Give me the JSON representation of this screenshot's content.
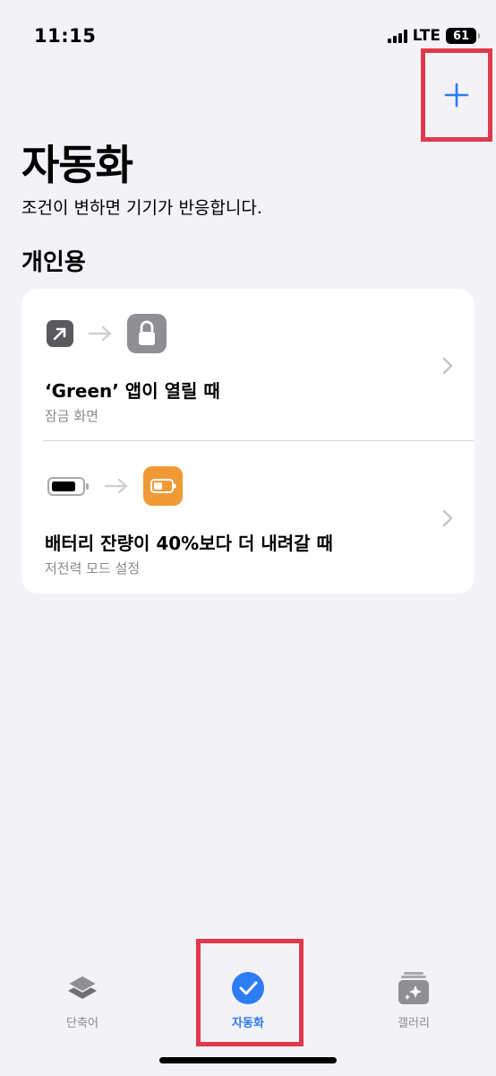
{
  "status": {
    "time": "11:15",
    "network": "LTE",
    "battery": "61"
  },
  "header": {
    "add_icon": "plus-icon",
    "title": "자동화",
    "subtitle": "조건이 변하면 기기가 반응합니다."
  },
  "section": {
    "title": "개인용"
  },
  "automations": [
    {
      "trigger_icon": "open-app-arrow-icon",
      "action_icon": "lock-icon",
      "title": "‘Green’ 앱이 열릴 때",
      "subtitle": "잠금 화면"
    },
    {
      "trigger_icon": "battery-icon",
      "action_icon": "low-power-battery-icon",
      "title": "배터리 잔량이 40%보다 더 내려갈 때",
      "subtitle": "저전력 모드 설정"
    }
  ],
  "tabs": [
    {
      "label": "단축어",
      "icon": "layers-icon",
      "active": false
    },
    {
      "label": "자동화",
      "icon": "checkmark-clock-icon",
      "active": true
    },
    {
      "label": "갤러리",
      "icon": "sparkles-gallery-icon",
      "active": false
    }
  ],
  "colors": {
    "accent": "#2c7cf6",
    "highlight": "#e0394b",
    "orange": "#f09a36",
    "background": "#f2f2f7"
  }
}
